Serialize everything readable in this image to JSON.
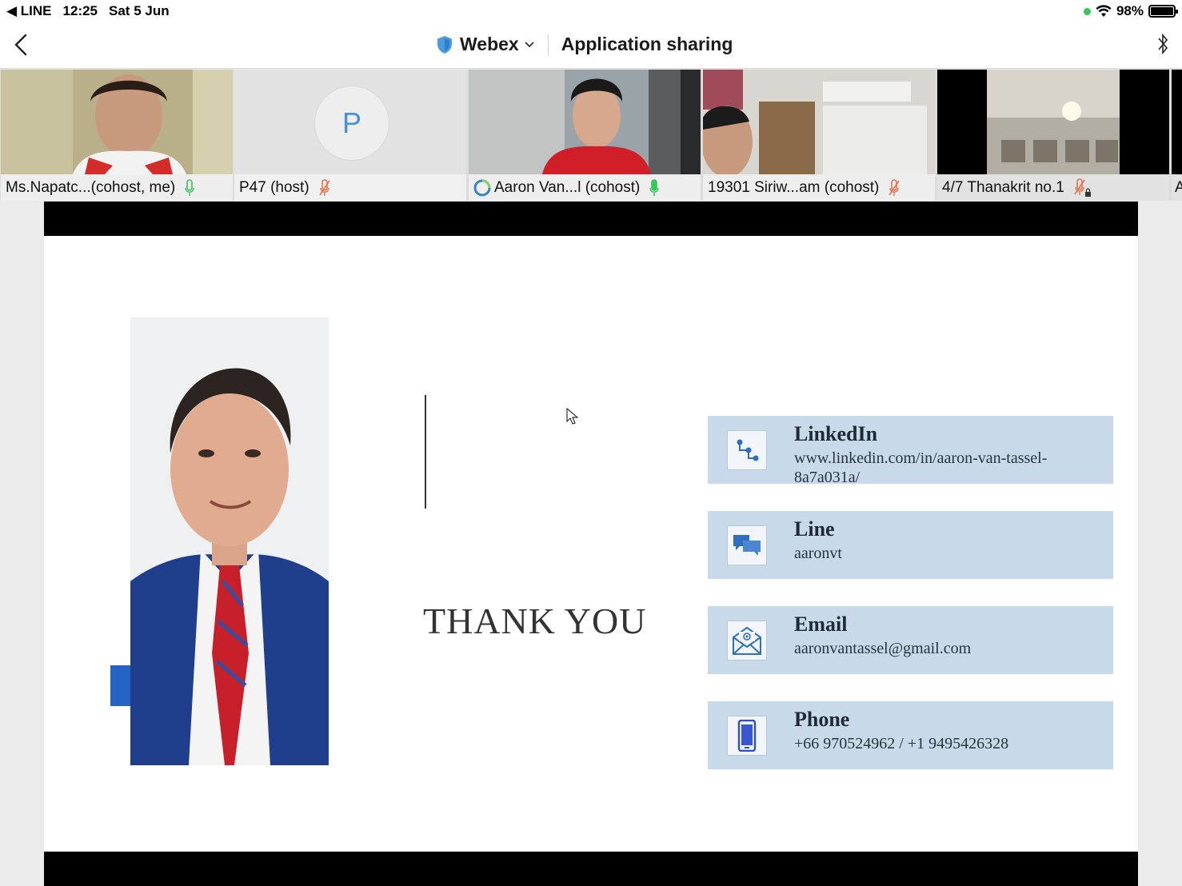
{
  "status_bar": {
    "back_app": "◀ LINE",
    "time": "12:25",
    "date": "Sat 5 Jun",
    "battery": "98%"
  },
  "nav": {
    "app_name": "Webex",
    "title": "Application sharing"
  },
  "participants": [
    {
      "name": "Ms.Napatc...(cohost, me)",
      "mic": "on"
    },
    {
      "name": "P47 (host)",
      "mic": "muted",
      "avatar_letter": "P"
    },
    {
      "name": "Aaron Van...l (cohost)",
      "mic": "on"
    },
    {
      "name": "19301 Siriw...am (cohost)",
      "mic": "muted"
    },
    {
      "name": "4/7 Thanakrit no.1",
      "mic": "muted-locked"
    },
    {
      "name": "A"
    }
  ],
  "slide": {
    "heading": "THANK YOU",
    "contacts": [
      {
        "icon": "linkedin-icon",
        "title": "LinkedIn",
        "value": "www.linkedin.com/in/aaron-van-tassel-8a7a031a/"
      },
      {
        "icon": "chat-icon",
        "title": "Line",
        "value": "aaronvt"
      },
      {
        "icon": "email-icon",
        "title": "Email",
        "value": "aaronvantassel@gmail.com"
      },
      {
        "icon": "phone-icon",
        "title": "Phone",
        "value": "+66 970524962 / +1 9495426328"
      }
    ]
  },
  "colors": {
    "accent_blue": "#2563c4",
    "card_bg": "#c8d9ea",
    "mic_on": "#34c759",
    "mic_muted": "#e8734a"
  }
}
